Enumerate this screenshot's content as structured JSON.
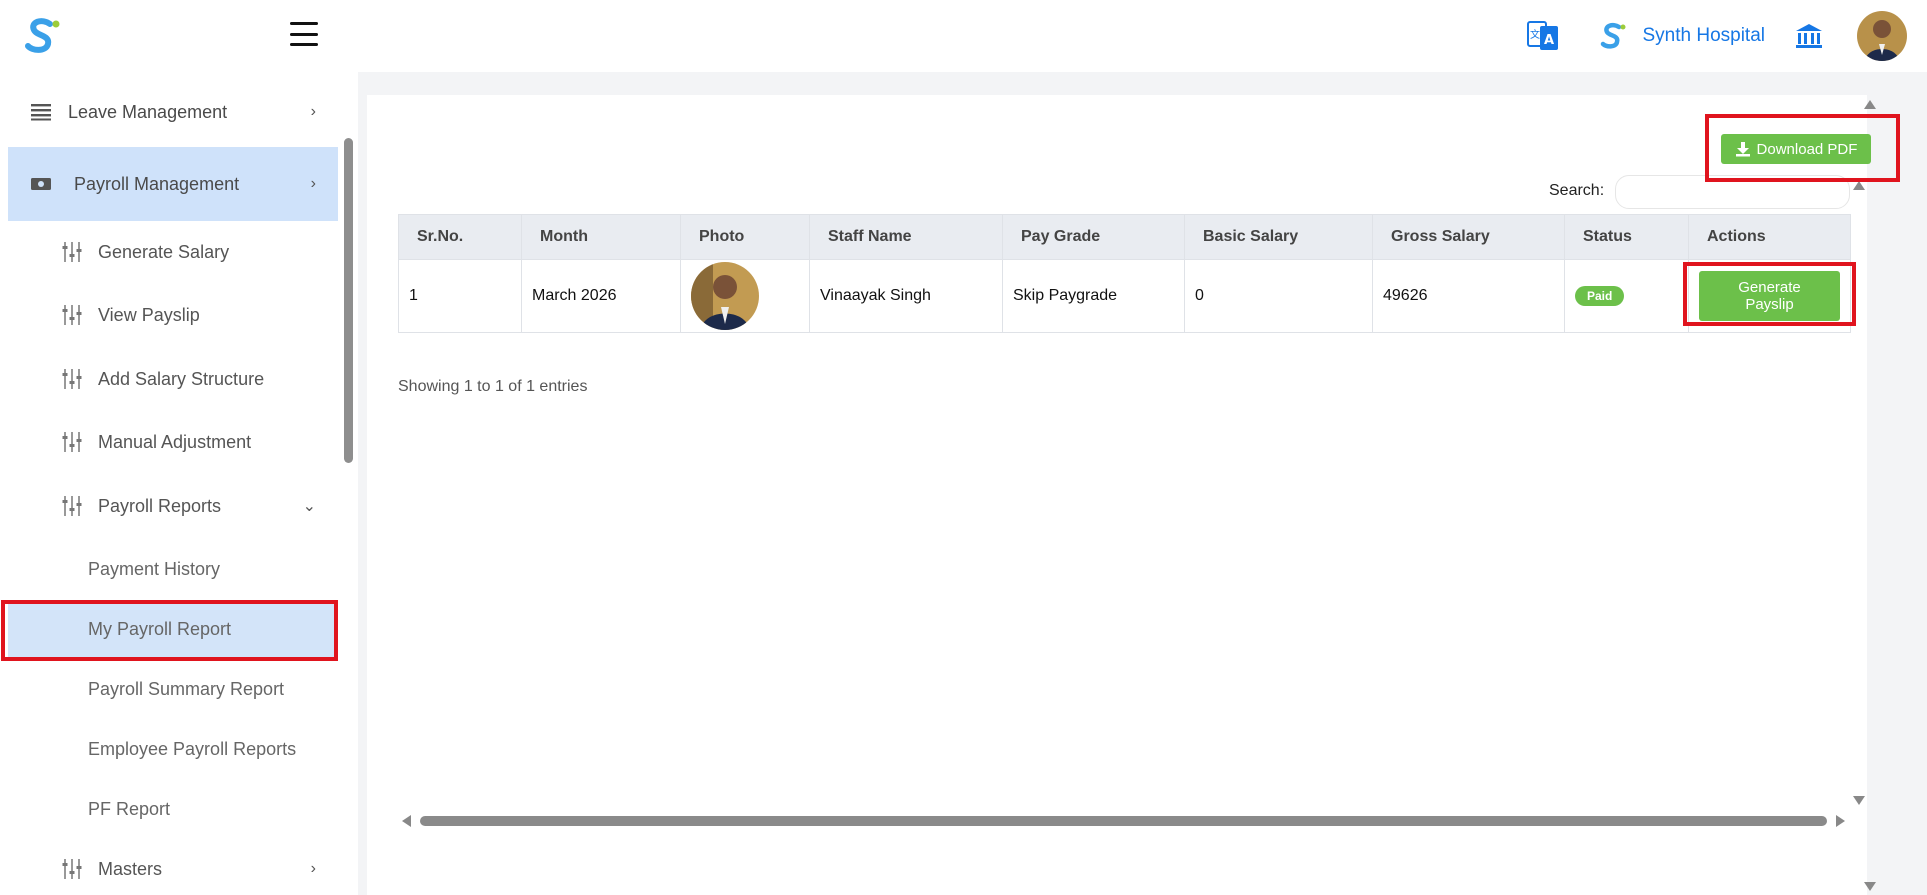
{
  "topbar": {
    "hospital_name": "Synth Hospital",
    "icons": [
      "app-logo",
      "menu-icon",
      "translate-icon",
      "small-logo",
      "bank-icon",
      "avatar"
    ]
  },
  "sidebar": {
    "items": [
      {
        "label": "Leave Management",
        "icon": "list-icon"
      },
      {
        "label": "Payroll Management",
        "icon": "cash-icon"
      },
      {
        "label": "Generate Salary",
        "icon": "sliders-icon"
      },
      {
        "label": "View Payslip",
        "icon": "sliders-icon"
      },
      {
        "label": "Add Salary Structure",
        "icon": "sliders-icon"
      },
      {
        "label": "Manual Adjustment",
        "icon": "sliders-icon"
      },
      {
        "label": "Payroll Reports",
        "icon": "sliders-icon"
      },
      {
        "label": "Payment History"
      },
      {
        "label": "My Payroll Report"
      },
      {
        "label": "Payroll Summary Report"
      },
      {
        "label": "Employee Payroll Reports"
      },
      {
        "label": "PF Report"
      },
      {
        "label": "Masters",
        "icon": "sliders-icon"
      }
    ]
  },
  "toolbar": {
    "download_label": "Download PDF",
    "search_label": "Search:",
    "search_value": ""
  },
  "table": {
    "headers": [
      "Sr.No.",
      "Month",
      "Photo",
      "Staff Name",
      "Pay Grade",
      "Basic Salary",
      "Gross Salary",
      "Status",
      "Actions"
    ],
    "rows": [
      {
        "sr_no": "1",
        "month": "March 2026",
        "staff_name": "Vinaayak Singh",
        "pay_grade": "Skip Paygrade",
        "basic_salary": "0",
        "gross_salary": "49626",
        "status": "Paid",
        "action_label": "Generate Payslip"
      }
    ]
  },
  "footer": {
    "info": "Showing 1 to 1 of 1 entries"
  },
  "colors": {
    "accent_green": "#6cc04a",
    "link_blue": "#1677e5",
    "active_bg": "#cfe2fa",
    "highlight_red": "#e0141e"
  }
}
